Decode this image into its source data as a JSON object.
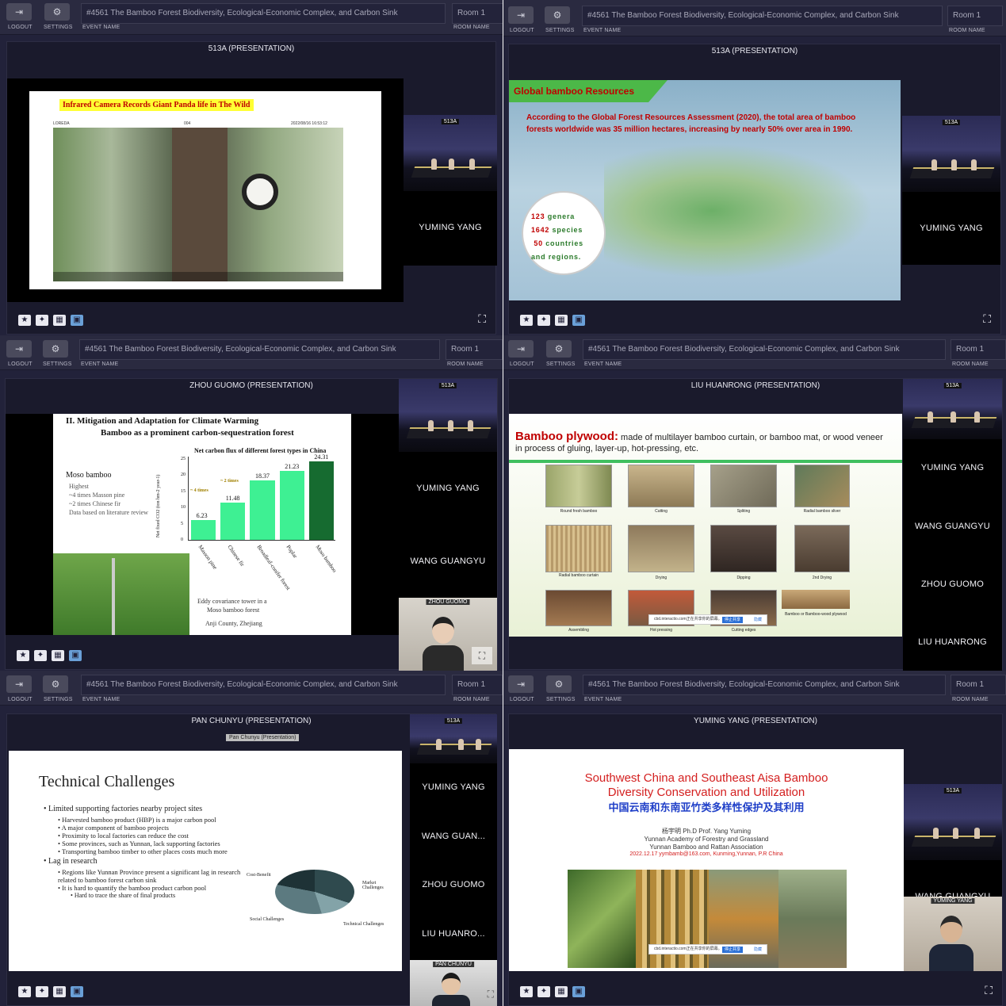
{
  "common": {
    "logout_label": "LOGOUT",
    "settings_label": "SETTINGS",
    "event_name_label": "EVENT NAME",
    "room_name_label": "ROOM NAME",
    "event_name": "#4561 The Bamboo Forest Biodiversity, Ecological-Economic Complex, and Carbon Sink",
    "room_name": "Room 1",
    "room_tag": "513A"
  },
  "panels": [
    {
      "stage_title": "513A (PRESENTATION)",
      "slide": {
        "title": "Infrared Camera Records Giant Panda life in The Wild",
        "stamp_left": "LOREDA",
        "stamp_mid": "004",
        "stamp_right": "2022/08/16 16:53:12"
      },
      "participants": [
        "YUMING YANG"
      ]
    },
    {
      "stage_title": "513A (PRESENTATION)",
      "slide": {
        "title": "Global bamboo Resources",
        "body": "According to the Global Forest Resources Assessment (2020), the total area of bamboo forests worldwide was 35 million hectares, increasing by nearly 50% over area in 1990.",
        "stats": [
          {
            "num": "123",
            "label": "genera"
          },
          {
            "num": "1642",
            "label": "species"
          },
          {
            "num": "50",
            "label": "countries"
          }
        ],
        "stats_tail": "and regions."
      },
      "participants": [
        "YUMING YANG"
      ]
    },
    {
      "stage_title": "ZHOU GUOMO (PRESENTATION)",
      "slide": {
        "heading1": "II. Mitigation and Adaptation for Climate Warming",
        "heading2": "Bamboo as a prominent carbon-sequestration forest",
        "left_title": "Moso bamboo",
        "bullets": [
          "Highest",
          "~4 times Masson pine",
          "~2 times Chinese fir",
          "Data based on literature review"
        ],
        "photo_caption1": "Eddy covariance tower in a",
        "photo_caption2": "Moso bamboo forest",
        "photo_caption3": "Anji County, Zhejiang",
        "times4": "~ 4 times",
        "times2": "~ 2 times"
      },
      "participants": [
        "YUMING YANG",
        "WANG GUANGYU"
      ],
      "speaker_tag": "ZHOU GUOMO"
    },
    {
      "stage_title": "LIU HUANRONG (PRESENTATION)",
      "slide": {
        "title_bold": "Bamboo plywood:",
        "title_rest": " made of multilayer bamboo curtain, or bamboo mat, or wood veneer in process of gluing, layer-up, hot-pressing, etc.",
        "steps": [
          "Round fresh bamboo",
          "Cutting",
          "Spliting",
          "Radial bamboo sliver",
          "Radial bamboo curtain",
          "Drying",
          "Dipping",
          "2nd Drying",
          "Assembling",
          "Hot pressing",
          "Cutting edges",
          "Bamboo or Bamboo-wood plywood"
        ]
      },
      "participants": [
        "YUMING YANG",
        "WANG GUANGYU",
        "ZHOU GUOMO",
        "LIU HUANRONG"
      ]
    },
    {
      "stage_title": "PAN CHUNYU (PRESENTATION)",
      "tooltip": "Pan Chunyu (Presentation)",
      "slide": {
        "title": "Technical Challenges",
        "b1": "Limited supporting factories nearby project sites",
        "b1a": "Harvested bamboo product (HBP) is a major carbon pool",
        "b1b": "A major component of bamboo projects",
        "b1c": "Proximity to local factories can reduce the cost",
        "b1d": "Some provinces, such as Yunnan, lack supporting factories",
        "b1e": "Transporting bamboo timber to other places costs much more",
        "b2": "Lag in research",
        "b2a": "Regions like Yunnan Province present a significant lag in research related to bamboo forest carbon sink",
        "b2b": "It is hard to quantify the bamboo product carbon pool",
        "b2c": "Hard to trace the share of final products",
        "pie_labels": [
          "Cost-Benefit",
          "Market Challenges",
          "Social Challenges",
          "Technical Challenges"
        ]
      },
      "participants": [
        "YUMING YANG",
        "WANG GUAN...",
        "ZHOU GUOMO",
        "LIU HUANRO..."
      ],
      "speaker_tag": "PAN CHUNYU"
    },
    {
      "stage_title": "YUMING YANG (PRESENTATION)",
      "slide": {
        "title_en1": "Southwest China and Southeast Aisa   Bamboo",
        "title_en2": "Diversity Conservation and Utilization",
        "title_cn": "中国云南和东南亚竹类多样性保护及其利用",
        "author": "杨宇明      Ph.D Prof. Yang Yuming",
        "org1": "Yunnan Academy of Forestry and Grassland",
        "org2": "Yunnan Bamboo and Rattan Association",
        "date": "2022.12.17  yymbamb@163.com, Kunming,Yunnan, P.R China",
        "share_bar": "cbd.interactio.com正在共享你的屏幕。",
        "share_btn": "停止共享",
        "hide_btn": "隐藏"
      },
      "participants": [
        "WANG GUANGYU"
      ],
      "speaker_tag": "YUMING YANG"
    }
  ],
  "chart_data": {
    "type": "bar",
    "title": "Net carbon flux of different forest types in China",
    "categories": [
      "Masson pine",
      "Chinese fir",
      "Broadleaf-conifer forest",
      "Poplar",
      "Moso bamboo"
    ],
    "values": [
      6.23,
      11.48,
      18.37,
      21.23,
      24.31
    ],
    "ylabel": "Net fixed CO2 (ton hm-2 year-1)",
    "ylim": [
      0,
      25
    ],
    "yticks": [
      0,
      5,
      10,
      15,
      20,
      25
    ]
  },
  "colors": {
    "bar": "#3ef093",
    "bar_highlight": "#166b30",
    "panel_bg": "#22223a"
  }
}
